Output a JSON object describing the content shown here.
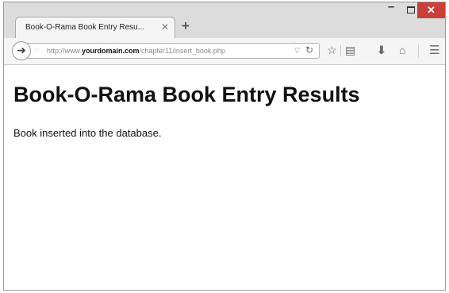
{
  "browser": {
    "tab_title": "Book-O-Rama Book Entry Resu...",
    "tab_close_icon": "close-icon",
    "new_tab_label": "+",
    "url": {
      "scheme_prefix": "http://www.",
      "domain": "yourdomain.com",
      "path": "/chapter11/insert_book.php"
    },
    "toolbar_icons": [
      "back-arrow-icon",
      "reload-icon",
      "bookmark-star-icon",
      "reading-list-icon",
      "download-icon",
      "home-icon",
      "menu-icon"
    ],
    "window_controls": [
      "minimize",
      "maximize",
      "close"
    ],
    "close_color": "#c9403a"
  },
  "page": {
    "heading": "Book-O-Rama Book Entry Results",
    "message": "Book inserted into the database."
  }
}
